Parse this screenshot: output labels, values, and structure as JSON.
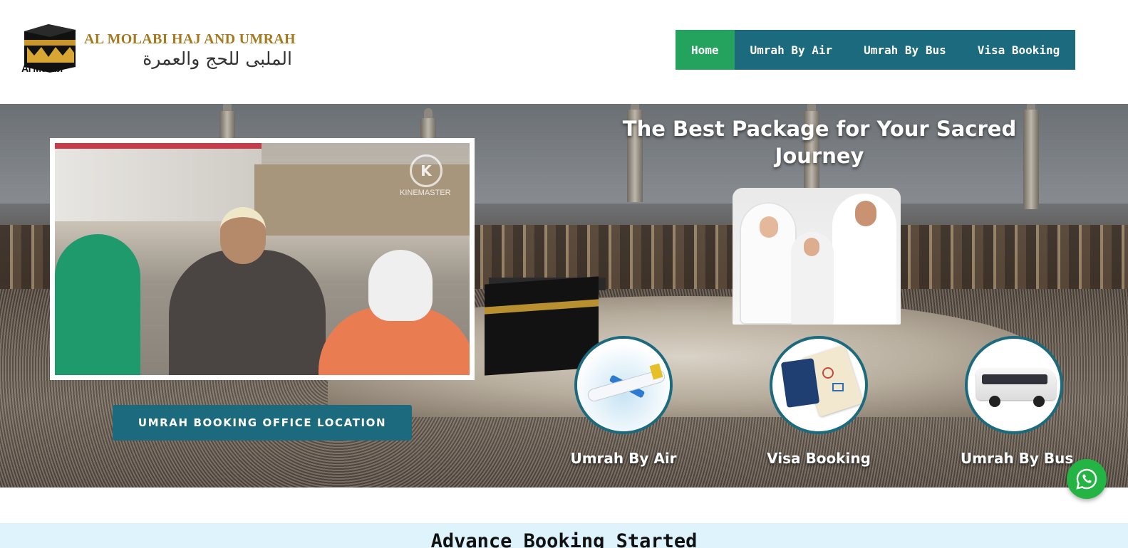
{
  "header": {
    "logo": {
      "name_en": "AL MOLABI HAJ AND UMRAH",
      "name_ar": "الملبى للحج والعمرة",
      "small_label": "Al Molabi"
    },
    "nav": [
      {
        "label": "Home",
        "active": true
      },
      {
        "label": "Umrah By Air",
        "active": false
      },
      {
        "label": "Umrah By Bus",
        "active": false
      },
      {
        "label": "Visa Booking",
        "active": false
      }
    ]
  },
  "hero": {
    "title": "The Best Package for Your Sacred Journey",
    "video_watermark": "K",
    "video_watermark_label": "KINEMASTER",
    "office_button": "UMRAH BOOKING OFFICE LOCATION",
    "services": [
      {
        "label": "Umrah By Air",
        "icon": "airplane-icon"
      },
      {
        "label": "Visa Booking",
        "icon": "passport-icon"
      },
      {
        "label": "Umrah By Bus",
        "icon": "bus-icon"
      }
    ]
  },
  "whatsapp": {
    "icon": "whatsapp-icon"
  },
  "advance": {
    "title": "Advance Booking Started"
  },
  "colors": {
    "nav_bg": "#1c6a7d",
    "nav_active": "#24a35f",
    "brand_gold": "#a57a1c",
    "whatsapp": "#23b443",
    "advance_bg": "#def3fb"
  }
}
